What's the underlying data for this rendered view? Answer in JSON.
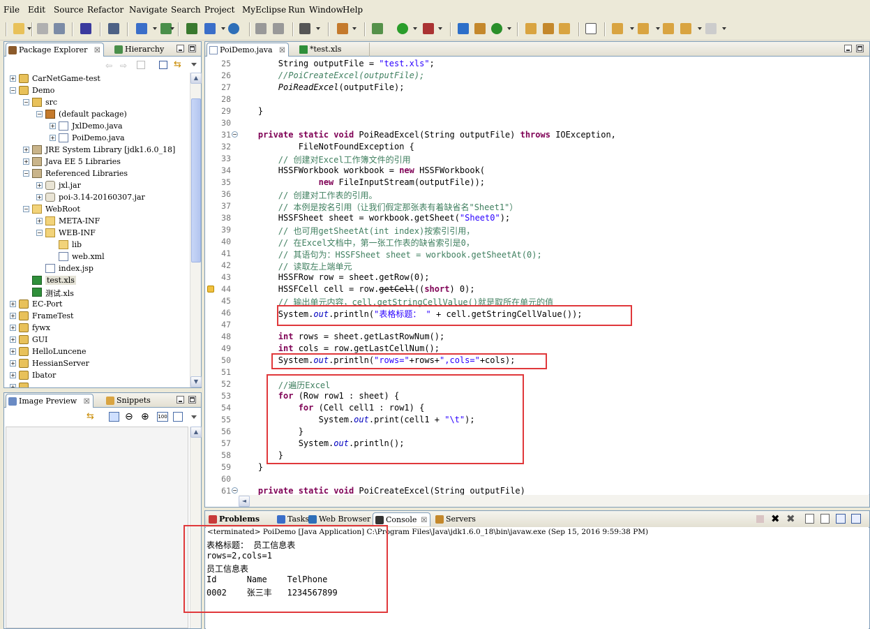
{
  "menu": [
    "File",
    "Edit",
    "Source",
    "Refactor",
    "Navigate",
    "Search",
    "Project",
    "MyEclipse",
    "Run",
    "Window",
    "Help"
  ],
  "package_explorer": {
    "tabs": [
      "Package Explorer",
      "Hierarchy"
    ],
    "close_glyph": "☒",
    "tree": [
      {
        "label": "CarNetGame-test",
        "level": 0,
        "expander": "+",
        "icon": "project-icon"
      },
      {
        "label": "Demo",
        "level": 0,
        "expander": "−",
        "icon": "project-icon"
      },
      {
        "label": "src",
        "level": 1,
        "expander": "−",
        "icon": "source-folder-icon"
      },
      {
        "label": "(default package)",
        "level": 2,
        "expander": "−",
        "icon": "package-icon"
      },
      {
        "label": "JxlDemo.java",
        "level": 3,
        "expander": "+",
        "icon": "java-file-icon"
      },
      {
        "label": "PoiDemo.java",
        "level": 3,
        "expander": "+",
        "icon": "java-file-icon"
      },
      {
        "label": "JRE System Library [jdk1.6.0_18]",
        "level": 1,
        "expander": "+",
        "icon": "library-icon"
      },
      {
        "label": "Java EE 5 Libraries",
        "level": 1,
        "expander": "+",
        "icon": "library-icon"
      },
      {
        "label": "Referenced Libraries",
        "level": 1,
        "expander": "−",
        "icon": "library-icon"
      },
      {
        "label": "jxl.jar",
        "level": 2,
        "expander": "+",
        "icon": "jar-icon"
      },
      {
        "label": "poi-3.14-20160307.jar",
        "level": 2,
        "expander": "+",
        "icon": "jar-icon"
      },
      {
        "label": "WebRoot",
        "level": 1,
        "expander": "−",
        "icon": "folder-icon"
      },
      {
        "label": "META-INF",
        "level": 2,
        "expander": "+",
        "icon": "folder-icon"
      },
      {
        "label": "WEB-INF",
        "level": 2,
        "expander": "−",
        "icon": "folder-icon"
      },
      {
        "label": "lib",
        "level": 3,
        "expander": "",
        "icon": "folder-icon"
      },
      {
        "label": "web.xml",
        "level": 3,
        "expander": "",
        "icon": "xml-file-icon"
      },
      {
        "label": "index.jsp",
        "level": 2,
        "expander": "",
        "icon": "jsp-file-icon"
      },
      {
        "label": "test.xls",
        "level": 1,
        "expander": "",
        "icon": "excel-file-icon",
        "selected": true
      },
      {
        "label": "测试.xls",
        "level": 1,
        "expander": "",
        "icon": "excel-file-icon"
      },
      {
        "label": "EC-Port",
        "level": 0,
        "expander": "+",
        "icon": "project-icon"
      },
      {
        "label": "FrameTest",
        "level": 0,
        "expander": "+",
        "icon": "project-icon"
      },
      {
        "label": "fywx",
        "level": 0,
        "expander": "+",
        "icon": "project-icon"
      },
      {
        "label": "GUI",
        "level": 0,
        "expander": "+",
        "icon": "project-icon"
      },
      {
        "label": "HelloLuncene",
        "level": 0,
        "expander": "+",
        "icon": "project-icon"
      },
      {
        "label": "HessianServer",
        "level": 0,
        "expander": "+",
        "icon": "project-icon"
      },
      {
        "label": "Ibator",
        "level": 0,
        "expander": "+",
        "icon": "project-icon"
      },
      {
        "label": "....",
        "level": 0,
        "expander": "+",
        "icon": "project-icon"
      }
    ]
  },
  "image_preview": {
    "tabs": [
      "Image Preview",
      "Snippets"
    ]
  },
  "editor": {
    "tabs": [
      "PoiDemo.java",
      "*test.xls"
    ],
    "lines": [
      {
        "n": "25",
        "html": "        String outputFile = <span class=\"st\">\"test.xls\"</span>;"
      },
      {
        "n": "26",
        "html": "        <span class=\"cm it\">//PoiCreateExcel(outputFile);</span>"
      },
      {
        "n": "27",
        "html": "        <span class=\"it\">PoiReadExcel</span>(outputFile);"
      },
      {
        "n": "28",
        "html": ""
      },
      {
        "n": "29",
        "html": "    }"
      },
      {
        "n": "30",
        "html": ""
      },
      {
        "n": "31",
        "html": "    <span class=\"kw\">private static void</span> PoiReadExcel(String outputFile) <span class=\"kw\">throws</span> IOException,"
      },
      {
        "n": "32",
        "html": "            FileNotFoundException {"
      },
      {
        "n": "33",
        "html": "        <span class=\"cm\">// 创建对Excel工作簿文件的引用</span>"
      },
      {
        "n": "34",
        "html": "        HSSFWorkbook workbook = <span class=\"kw\">new</span> HSSFWorkbook("
      },
      {
        "n": "35",
        "html": "                <span class=\"kw\">new</span> FileInputStream(outputFile));"
      },
      {
        "n": "36",
        "html": "        <span class=\"cm\">// 创建对工作表的引用。</span>"
      },
      {
        "n": "37",
        "html": "        <span class=\"cm\">// 本例是按名引用（让我们假定那张表有着缺省名\"Sheet1\"）</span>"
      },
      {
        "n": "38",
        "html": "        HSSFSheet sheet = workbook.getSheet(<span class=\"st\">\"Sheet0\"</span>);"
      },
      {
        "n": "39",
        "html": "        <span class=\"cm\">// 也可用getSheetAt(int index)按索引引用，</span>"
      },
      {
        "n": "40",
        "html": "        <span class=\"cm\">// 在Excel文档中，第一张工作表的缺省索引是0，</span>"
      },
      {
        "n": "41",
        "html": "        <span class=\"cm\">// 其语句为：HSSFSheet sheet = workbook.getSheetAt(0);</span>"
      },
      {
        "n": "42",
        "html": "        <span class=\"cm\">// 读取左上端单元</span>"
      },
      {
        "n": "43",
        "html": "        HSSFRow row = sheet.getRow(0);"
      },
      {
        "n": "44",
        "html": "        HSSFCell cell = row.<span style=\"text-decoration:line-through\">getCell</span>((<span class=\"kw\">short</span>) 0);"
      },
      {
        "n": "45",
        "html": "        <span class=\"cm\">// 输出单元内容，cell.getStringCellValue()就是取所在单元的值</span>"
      },
      {
        "n": "46",
        "html": "        System.<span class=\"fd\">out</span>.println(<span class=\"st\">\"表格标题： \"</span> + cell.getStringCellValue());"
      },
      {
        "n": "47",
        "html": ""
      },
      {
        "n": "48",
        "html": "        <span class=\"kw\">int</span> rows = sheet.getLastRowNum();"
      },
      {
        "n": "49",
        "html": "        <span class=\"kw\">int</span> cols = row.getLastCellNum();"
      },
      {
        "n": "50",
        "html": "        System.<span class=\"fd\">out</span>.println(<span class=\"st\">\"rows=\"</span>+rows+<span class=\"st\">\",cols=\"</span>+cols);"
      },
      {
        "n": "51",
        "html": ""
      },
      {
        "n": "52",
        "html": "        <span class=\"cm\">//遍历Excel</span>"
      },
      {
        "n": "53",
        "html": "        <span class=\"kw\">for</span> (Row row1 : sheet) {"
      },
      {
        "n": "54",
        "html": "            <span class=\"kw\">for</span> (Cell cell1 : row1) {"
      },
      {
        "n": "55",
        "html": "                System.<span class=\"fd\">out</span>.print(cell1 + <span class=\"st\">\"\\t\"</span>);"
      },
      {
        "n": "56",
        "html": "            }"
      },
      {
        "n": "57",
        "html": "            System.<span class=\"fd\">out</span>.println();"
      },
      {
        "n": "58",
        "html": "        }"
      },
      {
        "n": "59",
        "html": "    }"
      },
      {
        "n": "60",
        "html": ""
      },
      {
        "n": "61",
        "html": "    <span class=\"kw\">private static void</span> PoiCreateExcel(String outputFile)"
      }
    ]
  },
  "bottom_tabs": [
    "Problems",
    "Tasks",
    "Web Browser",
    "Console",
    "Servers"
  ],
  "console": {
    "header": "<terminated> PoiDemo [Java Application] C:\\Program Files\\Java\\jdk1.6.0_18\\bin\\javaw.exe (Sep 15, 2016 9:59:38 PM)",
    "output": [
      "表格标题： 员工信息表",
      "rows=2,cols=1",
      "员工信息表",
      "Id      Name    TelPhone",
      "0002    张三丰   1234567899"
    ]
  }
}
